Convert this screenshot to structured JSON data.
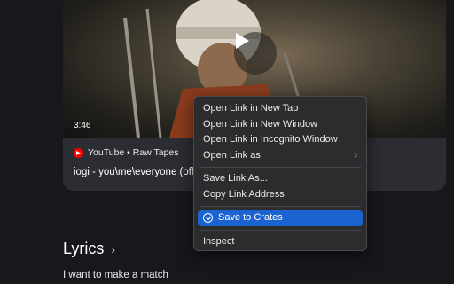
{
  "video": {
    "duration": "3:46",
    "source": "YouTube • Raw Tapes",
    "title": "iogi - you\\me\\everyone (official"
  },
  "lyrics": {
    "heading": "Lyrics",
    "chevron": "›",
    "first_line": "I want to make a match"
  },
  "context_menu": {
    "items": [
      {
        "label": "Open Link in New Tab"
      },
      {
        "label": "Open Link in New Window"
      },
      {
        "label": "Open Link in Incognito Window"
      },
      {
        "label": "Open Link as",
        "submenu_arrow": "›"
      },
      {
        "label": "Save Link As..."
      },
      {
        "label": "Copy Link Address"
      },
      {
        "label": "Save to Crates",
        "icon": "crate-icon",
        "highlighted": true
      },
      {
        "label": "Inspect"
      }
    ]
  },
  "colors": {
    "highlight": "#1a63d1",
    "youtube_red": "#ff0000",
    "background": "#17181c"
  }
}
